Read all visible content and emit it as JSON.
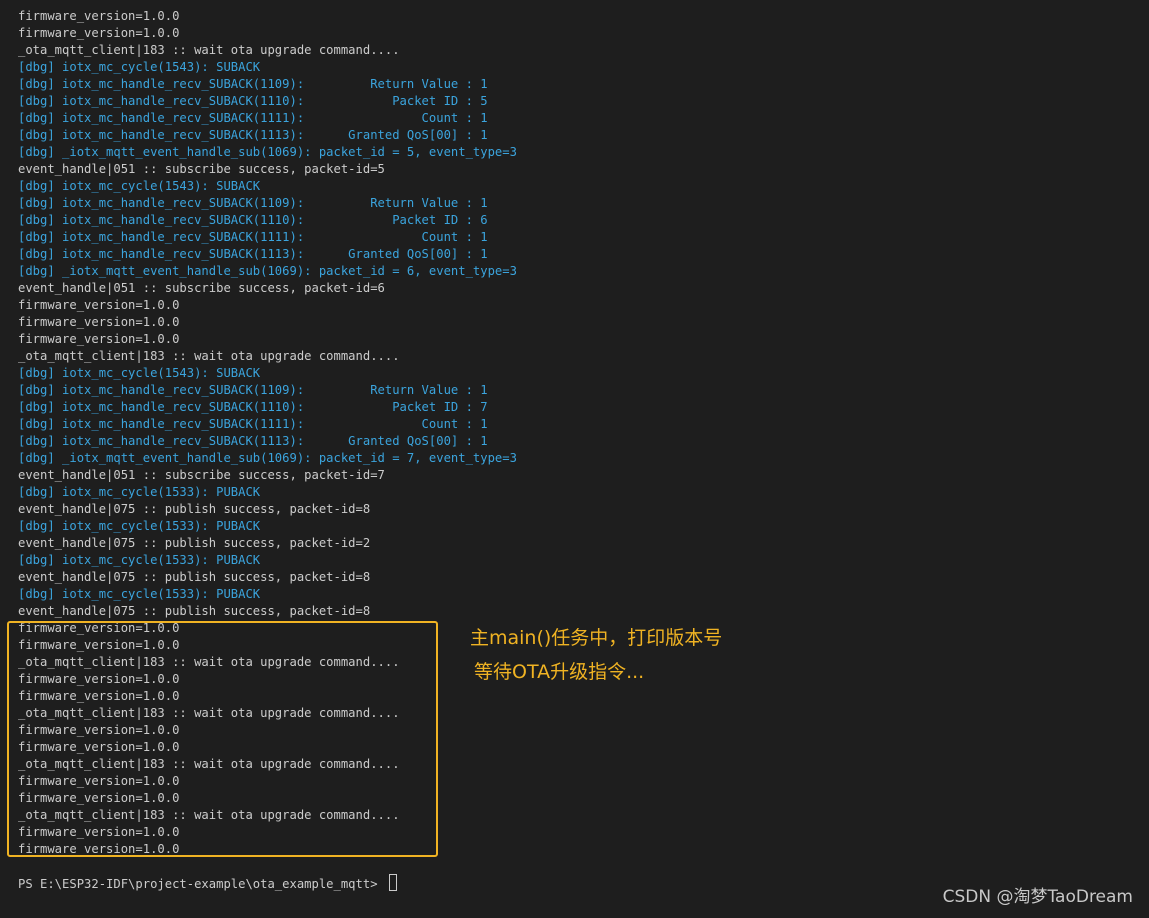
{
  "terminal": {
    "lines": [
      {
        "text": "firmware_version=1.0.0",
        "kind": "plain"
      },
      {
        "text": "firmware_version=1.0.0",
        "kind": "plain"
      },
      {
        "text": "_ota_mqtt_client|183 :: wait ota upgrade command....",
        "kind": "plain"
      },
      {
        "text": "[dbg] iotx_mc_cycle(1543): SUBACK",
        "kind": "dbg"
      },
      {
        "text": "[dbg] iotx_mc_handle_recv_SUBACK(1109):         Return Value : 1",
        "kind": "dbg"
      },
      {
        "text": "[dbg] iotx_mc_handle_recv_SUBACK(1110):            Packet ID : 5",
        "kind": "dbg"
      },
      {
        "text": "[dbg] iotx_mc_handle_recv_SUBACK(1111):                Count : 1",
        "kind": "dbg"
      },
      {
        "text": "[dbg] iotx_mc_handle_recv_SUBACK(1113):      Granted QoS[00] : 1",
        "kind": "dbg"
      },
      {
        "text": "[dbg] _iotx_mqtt_event_handle_sub(1069): packet_id = 5, event_type=3",
        "kind": "dbg"
      },
      {
        "text": "event_handle|051 :: subscribe success, packet-id=5",
        "kind": "plain"
      },
      {
        "text": "[dbg] iotx_mc_cycle(1543): SUBACK",
        "kind": "dbg"
      },
      {
        "text": "[dbg] iotx_mc_handle_recv_SUBACK(1109):         Return Value : 1",
        "kind": "dbg"
      },
      {
        "text": "[dbg] iotx_mc_handle_recv_SUBACK(1110):            Packet ID : 6",
        "kind": "dbg"
      },
      {
        "text": "[dbg] iotx_mc_handle_recv_SUBACK(1111):                Count : 1",
        "kind": "dbg"
      },
      {
        "text": "[dbg] iotx_mc_handle_recv_SUBACK(1113):      Granted QoS[00] : 1",
        "kind": "dbg"
      },
      {
        "text": "[dbg] _iotx_mqtt_event_handle_sub(1069): packet_id = 6, event_type=3",
        "kind": "dbg"
      },
      {
        "text": "event_handle|051 :: subscribe success, packet-id=6",
        "kind": "plain"
      },
      {
        "text": "firmware_version=1.0.0",
        "kind": "plain"
      },
      {
        "text": "firmware_version=1.0.0",
        "kind": "plain"
      },
      {
        "text": "firmware_version=1.0.0",
        "kind": "plain"
      },
      {
        "text": "_ota_mqtt_client|183 :: wait ota upgrade command....",
        "kind": "plain"
      },
      {
        "text": "[dbg] iotx_mc_cycle(1543): SUBACK",
        "kind": "dbg"
      },
      {
        "text": "[dbg] iotx_mc_handle_recv_SUBACK(1109):         Return Value : 1",
        "kind": "dbg"
      },
      {
        "text": "[dbg] iotx_mc_handle_recv_SUBACK(1110):            Packet ID : 7",
        "kind": "dbg"
      },
      {
        "text": "[dbg] iotx_mc_handle_recv_SUBACK(1111):                Count : 1",
        "kind": "dbg"
      },
      {
        "text": "[dbg] iotx_mc_handle_recv_SUBACK(1113):      Granted QoS[00] : 1",
        "kind": "dbg"
      },
      {
        "text": "[dbg] _iotx_mqtt_event_handle_sub(1069): packet_id = 7, event_type=3",
        "kind": "dbg"
      },
      {
        "text": "event_handle|051 :: subscribe success, packet-id=7",
        "kind": "plain"
      },
      {
        "text": "[dbg] iotx_mc_cycle(1533): PUBACK",
        "kind": "dbg"
      },
      {
        "text": "event_handle|075 :: publish success, packet-id=8",
        "kind": "plain"
      },
      {
        "text": "[dbg] iotx_mc_cycle(1533): PUBACK",
        "kind": "dbg"
      },
      {
        "text": "event_handle|075 :: publish success, packet-id=2",
        "kind": "plain"
      },
      {
        "text": "[dbg] iotx_mc_cycle(1533): PUBACK",
        "kind": "dbg"
      },
      {
        "text": "event_handle|075 :: publish success, packet-id=8",
        "kind": "plain"
      },
      {
        "text": "[dbg] iotx_mc_cycle(1533): PUBACK",
        "kind": "dbg"
      },
      {
        "text": "event_handle|075 :: publish success, packet-id=8",
        "kind": "plain"
      },
      {
        "text": "firmware_version=1.0.0",
        "kind": "plain"
      },
      {
        "text": "firmware_version=1.0.0",
        "kind": "plain"
      },
      {
        "text": "_ota_mqtt_client|183 :: wait ota upgrade command....",
        "kind": "plain"
      },
      {
        "text": "firmware_version=1.0.0",
        "kind": "plain"
      },
      {
        "text": "firmware_version=1.0.0",
        "kind": "plain"
      },
      {
        "text": "_ota_mqtt_client|183 :: wait ota upgrade command....",
        "kind": "plain"
      },
      {
        "text": "firmware_version=1.0.0",
        "kind": "plain"
      },
      {
        "text": "firmware_version=1.0.0",
        "kind": "plain"
      },
      {
        "text": "_ota_mqtt_client|183 :: wait ota upgrade command....",
        "kind": "plain"
      },
      {
        "text": "firmware_version=1.0.0",
        "kind": "plain"
      },
      {
        "text": "firmware_version=1.0.0",
        "kind": "plain"
      },
      {
        "text": "_ota_mqtt_client|183 :: wait ota upgrade command....",
        "kind": "plain"
      },
      {
        "text": "firmware_version=1.0.0",
        "kind": "plain"
      },
      {
        "text": "firmware_version=1.0.0",
        "kind": "plain"
      }
    ],
    "prompt": "PS E:\\ESP32-IDF\\project-example\\ota_example_mqtt> "
  },
  "annotation": {
    "line1": "主main()任务中，打印版本号",
    "line2": "等待OTA升级指令..."
  },
  "watermark": "CSDN @淘梦TaoDream",
  "colors": {
    "background": "#1e1e1e",
    "text": "#cccccc",
    "debug": "#3ba4dd",
    "highlight": "#f0b323"
  }
}
